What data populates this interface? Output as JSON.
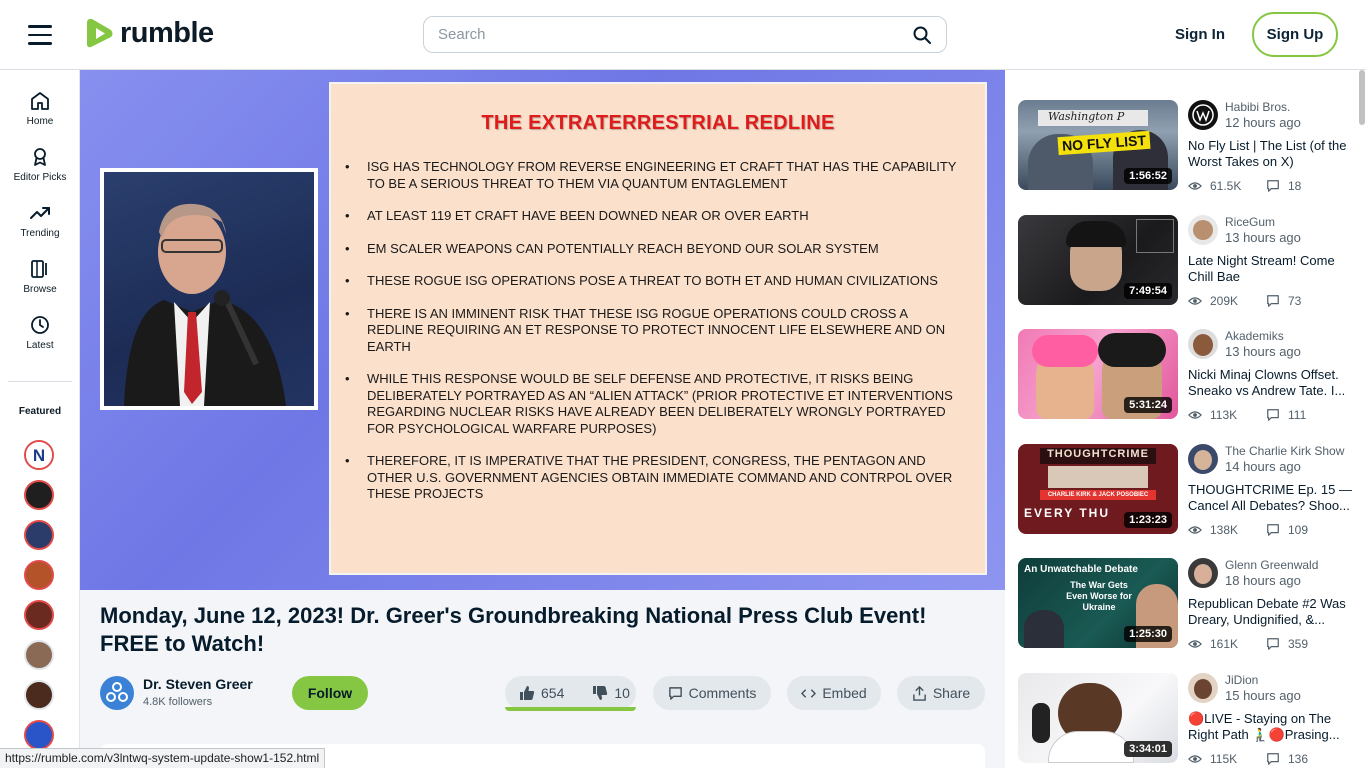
{
  "header": {
    "logo_text": "rumble",
    "search_placeholder": "Search",
    "sign_in": "Sign In",
    "sign_up": "Sign Up",
    "brand_color": "#85c742"
  },
  "leftnav": {
    "items": [
      {
        "label": "Home",
        "icon": "home-icon"
      },
      {
        "label": "Editor Picks",
        "icon": "award-icon"
      },
      {
        "label": "Trending",
        "icon": "trending-icon"
      },
      {
        "label": "Browse",
        "icon": "browse-icon"
      },
      {
        "label": "Latest",
        "icon": "clock-icon"
      }
    ],
    "featured_label": "Featured"
  },
  "slide": {
    "title": "THE EXTRATERRESTRIAL REDLINE",
    "bullets": [
      "ISG HAS TECHNOLOGY FROM REVERSE ENGINEERING ET CRAFT THAT HAS THE CAPABILITY TO BE A SERIOUS THREAT TO THEM VIA QUANTUM ENTAGLEMENT",
      "AT LEAST 119 ET CRAFT HAVE BEEN DOWNED NEAR OR OVER EARTH",
      "EM SCALER WEAPONS CAN POTENTIALLY REACH BEYOND OUR SOLAR SYSTEM",
      "THESE ROGUE ISG OPERATIONS POSE A THREAT TO BOTH ET AND HUMAN CIVILIZATIONS",
      "THERE IS AN IMMINENT RISK THAT THESE ISG ROGUE OPERATIONS COULD CROSS A REDLINE REQUIRING AN ET RESPONSE TO PROTECT INNOCENT LIFE ELSEWHERE AND ON EARTH",
      "WHILE THIS RESPONSE WOULD BE SELF DEFENSE AND PROTECTIVE, IT RISKS BEING DELIBERATELY PORTRAYED AS AN “ALIEN ATTACK” (PRIOR PROTECTIVE ET INTERVENTIONS REGARDING NUCLEAR RISKS HAVE ALREADY BEEN DELIBERATELY WRONGLY PORTRAYED FOR PSYCHOLOGICAL WARFARE PURPOSES)",
      "THEREFORE, IT IS IMPERATIVE THAT THE PRESIDENT, CONGRESS, THE PENTAGON AND OTHER U.S. GOVERNMENT AGENCIES OBTAIN IMMEDIATE COMMAND AND CONTRPOL OVER THESE PROJECTS"
    ]
  },
  "video": {
    "title": "Monday, June 12, 2023! Dr. Greer's Groundbreaking National Press Club Event! FREE to Watch!",
    "channel": "Dr. Steven Greer",
    "followers": "4.8K followers",
    "follow_label": "Follow",
    "likes": "654",
    "dislikes": "10",
    "comments_label": "Comments",
    "embed_label": "Embed",
    "share_label": "Share"
  },
  "sidebar": {
    "items": [
      {
        "channel": "Habibi Bros.",
        "ago": "12 hours ago",
        "title": "No Fly List | The List (of the Worst Takes on X)",
        "duration": "1:56:52",
        "views": "61.5K",
        "comments": "18"
      },
      {
        "channel": "RiceGum",
        "ago": "13 hours ago",
        "title": "Late Night Stream! Come Chill Bae",
        "duration": "7:49:54",
        "views": "209K",
        "comments": "73"
      },
      {
        "channel": "Akademiks",
        "ago": "13 hours ago",
        "title": "Nicki Minaj Clowns Offset. Sneako vs Andrew Tate. I...",
        "duration": "5:31:24",
        "views": "113K",
        "comments": "111"
      },
      {
        "channel": "The Charlie Kirk Show",
        "ago": "14 hours ago",
        "title": "THOUGHTCRIME Ep. 15 — Cancel All Debates? Shoo...",
        "duration": "1:23:23",
        "views": "138K",
        "comments": "109"
      },
      {
        "channel": "Glenn Greenwald",
        "ago": "18 hours ago",
        "title": "Republican Debate #2 Was Dreary, Undignified, &...",
        "duration": "1:25:30",
        "views": "161K",
        "comments": "359"
      },
      {
        "channel": "JiDion",
        "ago": "15 hours ago",
        "title": "🔴LIVE - Staying on The Right Path 🧎‍♂️🔴Prasing...",
        "duration": "3:34:01",
        "views": "115K",
        "comments": "136"
      }
    ],
    "thumb_texts": {
      "t1_banner": "NO FLY LIST",
      "t1_paper": "Washington P",
      "t4_title": "THOUGHTCRIME",
      "t4_sub": "CHARLIE KIRK & JACK POSOBIEC",
      "t4_bottom": "EVERY THU",
      "t5_top": "An Unwatchable Debate",
      "t5_main": "The War Gets Even Worse for Ukraine"
    }
  },
  "status_bar": {
    "url": "https://rumble.com/v3lntwq-system-update-show1-152.html"
  }
}
